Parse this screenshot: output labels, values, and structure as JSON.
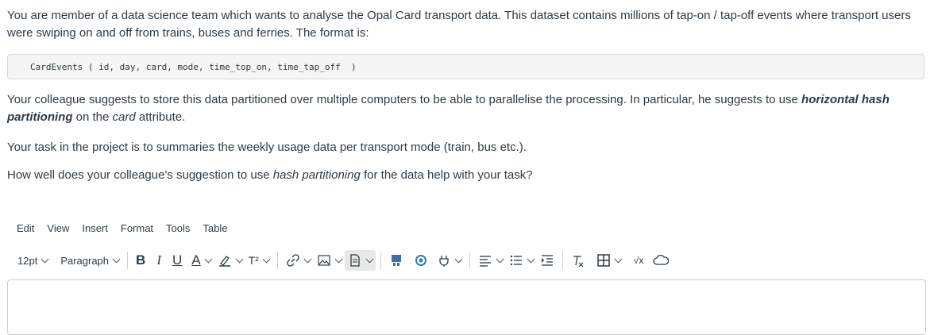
{
  "question": {
    "intro": "You are member of a data science team which wants to analyse the Opal Card transport data. This dataset contains millions of tap-on / tap-off events where transport users were swiping on and off from trains, buses and ferries. The format is:",
    "schema": "CardEvents ( id, day, card, mode, time_top_on, time_tap_off  )",
    "p2_a": "Your colleague suggests to store this data partitioned over multiple computers to be able to parallelise the processing. In particular, he suggests to use ",
    "p2_b": "horizontal hash partitioning",
    "p2_c": " on the ",
    "p2_d": "card",
    "p2_e": " attribute.",
    "p3": "Your task in the project is to summaries the weekly usage data per transport mode (train, bus etc.).",
    "p4_a": "How well does your colleague's suggestion to use ",
    "p4_b": "hash partitioning",
    "p4_c": " for the data help with your task?"
  },
  "menubar": {
    "edit": "Edit",
    "view": "View",
    "insert": "Insert",
    "format": "Format",
    "tools": "Tools",
    "table": "Table"
  },
  "toolbar": {
    "font_size": "12pt",
    "block_format": "Paragraph",
    "bold": "B",
    "italic": "I",
    "underline": "U",
    "text_color": "A",
    "superscript": "T²",
    "equation": "√x"
  },
  "editor": {
    "value": ""
  }
}
